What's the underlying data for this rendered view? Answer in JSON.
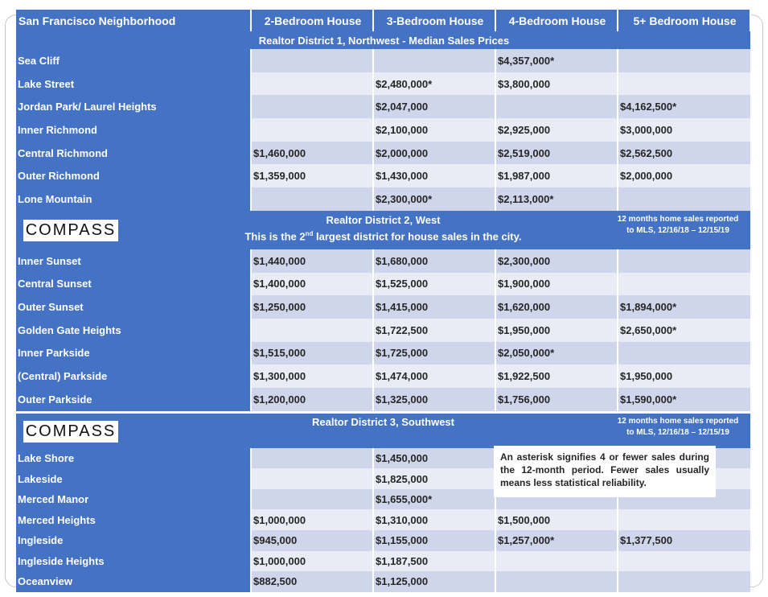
{
  "header": {
    "neighborhood": "San Francisco Neighborhood",
    "col2": "2-Bedroom House",
    "col3": "3-Bedroom House",
    "col4": "4-Bedroom House",
    "col5": "5+ Bedroom House"
  },
  "district1": {
    "title": "Realtor District 1, Northwest  - Median Sales Prices",
    "rows": [
      {
        "name": "Sea Cliff",
        "b2": "",
        "b3": "",
        "b4": "$4,357,000*",
        "b5": ""
      },
      {
        "name": "Lake Street",
        "b2": "",
        "b3": "$2,480,000*",
        "b4": "$3,800,000",
        "b5": ""
      },
      {
        "name": "Jordan Park/ Laurel Heights",
        "b2": "",
        "b3": "$2,047,000",
        "b4": "",
        "b5": "$4,162,500*"
      },
      {
        "name": "Inner Richmond",
        "b2": "",
        "b3": "$2,100,000",
        "b4": "$2,925,000",
        "b5": "$3,000,000"
      },
      {
        "name": "Central Richmond",
        "b2": "$1,460,000",
        "b3": "$2,000,000",
        "b4": "$2,519,000",
        "b5": "$2,562,500"
      },
      {
        "name": "Outer Richmond",
        "b2": "$1,359,000",
        "b3": "$1,430,000",
        "b4": "$1,987,000",
        "b5": "$2,000,000"
      },
      {
        "name": "Lone Mountain",
        "b2": "",
        "b3": "$2,300,000*",
        "b4": "$2,113,000*",
        "b5": ""
      }
    ]
  },
  "district2": {
    "logo": "COMPASS",
    "title": "Realtor District 2, West",
    "subtitle_pre": "This is the 2",
    "subtitle_sup": "nd",
    "subtitle_post": " largest district for house sales in the city.",
    "note_line1": "12 months home sales reported",
    "note_line2": "to MLS, 12/16/18 – 12/15/19",
    "rows": [
      {
        "name": "Inner Sunset",
        "b2": "$1,440,000",
        "b3": "$1,680,000",
        "b4": "$2,300,000",
        "b5": ""
      },
      {
        "name": "Central Sunset",
        "b2": "$1,400,000",
        "b3": "$1,525,000",
        "b4": "$1,900,000",
        "b5": ""
      },
      {
        "name": "Outer Sunset",
        "b2": "$1,250,000",
        "b3": "$1,415,000",
        "b4": "$1,620,000",
        "b5": "$1,894,000*"
      },
      {
        "name": "Golden Gate Heights",
        "b2": "",
        "b3": "$1,722,500",
        "b4": "$1,950,000",
        "b5": "$2,650,000*"
      },
      {
        "name": "Inner Parkside",
        "b2": "$1,515,000",
        "b3": "$1,725,000",
        "b4": "$2,050,000*",
        "b5": ""
      },
      {
        "name": "(Central) Parkside",
        "b2": "$1,300,000",
        "b3": "$1,474,000",
        "b4": "$1,922,500",
        "b5": "$1,950,000"
      },
      {
        "name": "Outer Parkside",
        "b2": "$1,200,000",
        "b3": "$1,325,000",
        "b4": "$1,756,000",
        "b5": "$1,590,000*"
      }
    ]
  },
  "district3": {
    "logo": "COMPASS",
    "title": "Realtor District 3, Southwest",
    "note_line1": "12 months home sales reported",
    "note_line2": "to MLS, 12/16/18 – 12/15/19",
    "rows": [
      {
        "name": "Lake Shore",
        "b2": "",
        "b3": "$1,450,000",
        "b4": "",
        "b5": ""
      },
      {
        "name": "Lakeside",
        "b2": "",
        "b3": "$1,825,000",
        "b4": "",
        "b5": ""
      },
      {
        "name": "Merced Manor",
        "b2": "",
        "b3": "$1,655,000*",
        "b4": "",
        "b5": ""
      },
      {
        "name": "Merced Heights",
        "b2": "$1,000,000",
        "b3": "$1,310,000",
        "b4": "$1,500,000",
        "b5": ""
      },
      {
        "name": "Ingleside",
        "b2": "$945,000",
        "b3": "$1,155,000",
        "b4": "$1,257,000*",
        "b5": "$1,377,500"
      },
      {
        "name": "Ingleside Heights",
        "b2": "$1,000,000",
        "b3": "$1,187,500",
        "b4": "",
        "b5": ""
      },
      {
        "name": "Oceanview",
        "b2": "$882,500",
        "b3": "$1,125,000",
        "b4": "",
        "b5": ""
      }
    ]
  },
  "callout": "An asterisk signifies 4 or fewer sales during the 12-month period. Fewer sales usually means less statistical reliability."
}
